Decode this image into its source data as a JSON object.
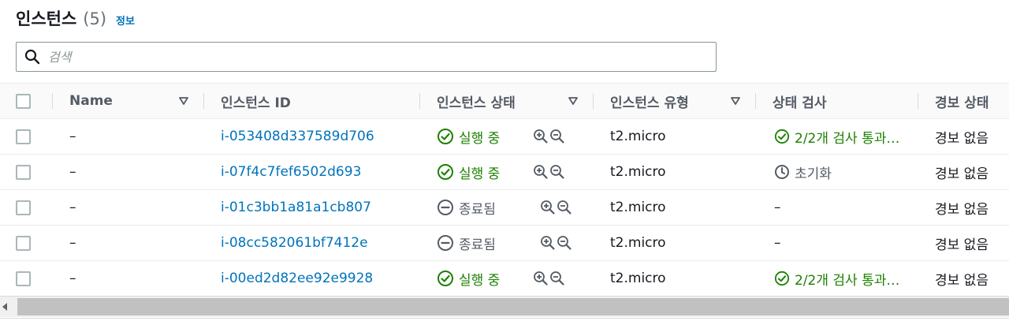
{
  "header": {
    "title": "인스턴스",
    "count": "(5)",
    "info_link": "정보"
  },
  "search": {
    "placeholder": "검색",
    "value": ""
  },
  "table": {
    "columns": {
      "name": "Name",
      "instance_id": "인스턴스 ID",
      "instance_state": "인스턴스 상태",
      "instance_type": "인스턴스 유형",
      "status_check": "상태 검사",
      "alarm_status": "경보 상태"
    },
    "rows": [
      {
        "name": "–",
        "instance_id": "i-053408d337589d706",
        "state": "실행 중",
        "state_kind": "running",
        "type": "t2.micro",
        "status_check": "2/2개 검사 통과…",
        "status_kind": "passed",
        "alarm": "경보 없음"
      },
      {
        "name": "–",
        "instance_id": "i-07f4c7fef6502d693",
        "state": "실행 중",
        "state_kind": "running",
        "type": "t2.micro",
        "status_check": "초기화",
        "status_kind": "initializing",
        "alarm": "경보 없음"
      },
      {
        "name": "–",
        "instance_id": "i-01c3bb1a81a1cb807",
        "state": "종료됨",
        "state_kind": "terminated",
        "type": "t2.micro",
        "status_check": "–",
        "status_kind": "none",
        "alarm": "경보 없음"
      },
      {
        "name": "–",
        "instance_id": "i-08cc582061bf7412e",
        "state": "종료됨",
        "state_kind": "terminated",
        "type": "t2.micro",
        "status_check": "–",
        "status_kind": "none",
        "alarm": "경보 없음"
      },
      {
        "name": "–",
        "instance_id": "i-00ed2d82ee92e9928",
        "state": "실행 중",
        "state_kind": "running",
        "type": "t2.micro",
        "status_check": "2/2개 검사 통과…",
        "status_kind": "passed",
        "alarm": "경보 없음"
      }
    ]
  },
  "icons": {
    "search": "search-icon",
    "sort": "sort-caret-down-icon",
    "running": "check-circle-icon",
    "terminated": "minus-circle-icon",
    "initializing": "clock-icon",
    "zoom_in": "zoom-in-icon",
    "zoom_out": "zoom-out-icon"
  },
  "colors": {
    "link": "#0073bb",
    "success": "#1d8102",
    "muted": "#545b64"
  }
}
